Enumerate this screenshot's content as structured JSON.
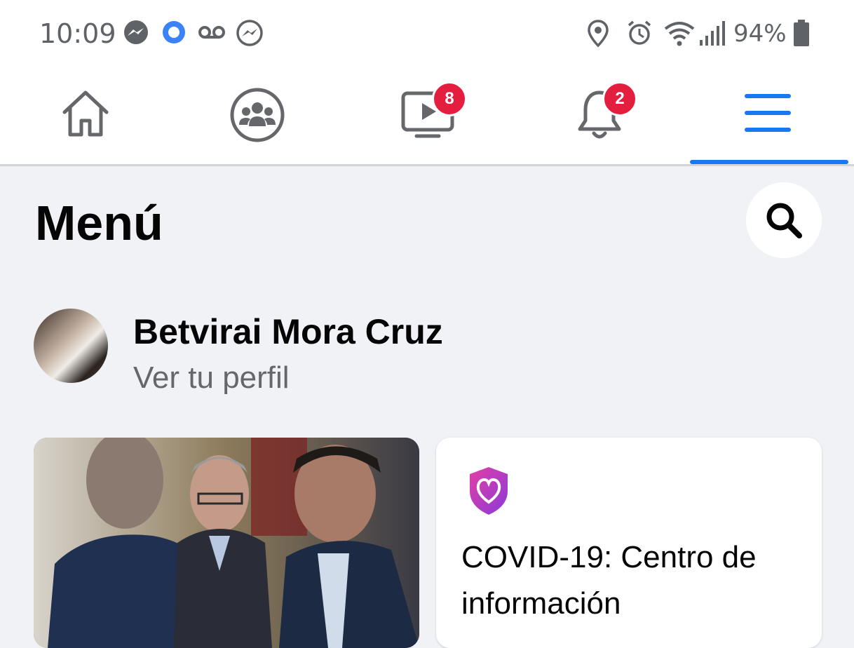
{
  "status_bar": {
    "time": "10:09",
    "battery": "94%",
    "icons_left": [
      "messenger-icon",
      "circle-app-icon",
      "voicemail-icon",
      "messenger-outline-icon"
    ],
    "icons_right": [
      "location-icon",
      "alarm-icon",
      "wifi-icon",
      "signal-icon",
      "battery-icon"
    ]
  },
  "nav": {
    "tabs": [
      {
        "name": "home",
        "icon": "home-icon"
      },
      {
        "name": "groups",
        "icon": "groups-icon"
      },
      {
        "name": "watch",
        "icon": "video-icon",
        "badge": "8"
      },
      {
        "name": "notifications",
        "icon": "bell-icon",
        "badge": "2"
      },
      {
        "name": "menu",
        "icon": "hamburger-icon",
        "active": true
      }
    ],
    "accent": "#1877f2",
    "badge_color": "#e41e3f"
  },
  "header": {
    "title": "Menú"
  },
  "profile": {
    "name": "Betvirai Mora Cruz",
    "subtitle": "Ver tu perfil"
  },
  "cards": {
    "covid": {
      "title": "COVID-19: Centro de información",
      "icon": "covid-shield-heart-icon"
    }
  }
}
